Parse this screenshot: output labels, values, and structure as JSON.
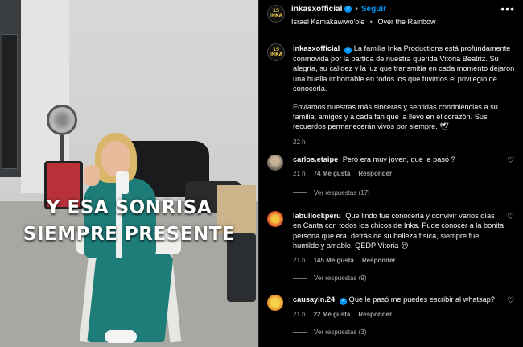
{
  "media": {
    "overlay_line1": "Y ESA SONRISA",
    "overlay_line2": "SIEMPRE PRESENTE"
  },
  "header": {
    "username": "inkasxofficial",
    "separator": "•",
    "follow_label": "Seguir",
    "artist": "Israel Kamakawiwo'ole",
    "song_separator": "•",
    "song": "Over the Rainbow",
    "more_icon": "more-horizontal-icon"
  },
  "caption": {
    "username": "inkasxofficial",
    "paragraph1": "La familia Inka Productions está profundamente conmovida por la partida de nuestra querida Vitoria Beatriz. Su alegría, su calidez y la luz que transmitía en cada momento dejaron una huella imborrable en todos los que tuvimos el privilegio de conocerla.",
    "paragraph2": "Enviamos nuestras más sinceras y sentidas condolencias a su familia, amigos y a cada fan que la llevó en el corazón. Sus recuerdos permanecerán vivos por siempre. 🕊",
    "time": "22 h"
  },
  "comments": [
    {
      "username": "carlos.etaipe",
      "verified": false,
      "text": "Pero era muy joven, que le pasó ?",
      "time": "21 h",
      "likes": "74 Me gusta",
      "reply_label": "Responder",
      "view_replies": "Ver respuestas (17)"
    },
    {
      "username": "labullockperu",
      "verified": false,
      "text": "Que lindo fue conocería y convivir varios días en Canta con todos los chicos de Inka. Pude conocer a la bonita persona que era, detrás de su belleza física, siempre fue humilde y amable. QEDP Vitoria 😢",
      "time": "21 h",
      "likes": "145 Me gusta",
      "reply_label": "Responder",
      "view_replies": "Ver respuestas (9)"
    },
    {
      "username": "causayin.24",
      "verified": true,
      "text": "Que le pasó me puedes escribir al whatsap?",
      "time": "21 h",
      "likes": "22 Me gusta",
      "reply_label": "Responder",
      "view_replies": "Ver respuestas (3)"
    }
  ],
  "colors": {
    "accent": "#0095f6",
    "muted": "#a8a8a8",
    "background": "#000000"
  }
}
